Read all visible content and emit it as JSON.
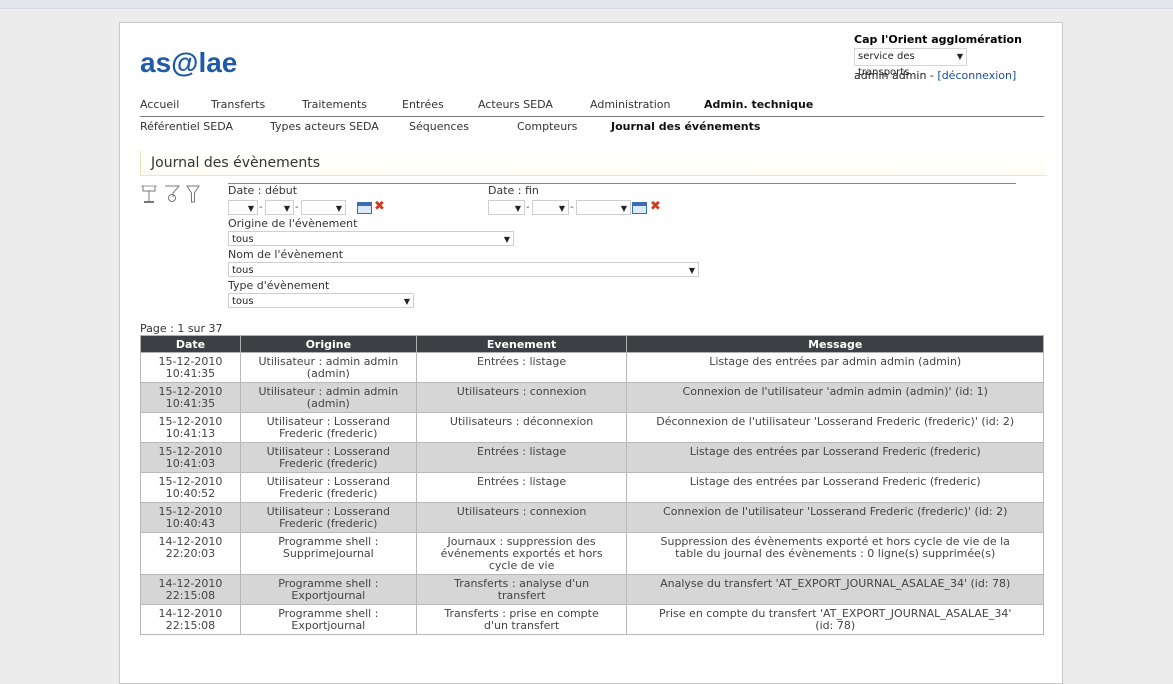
{
  "header": {
    "logo_text": "as@lae",
    "org_name": "Cap l'Orient agglomération",
    "service_value": "service des transports",
    "user_text": "admin admin - ",
    "logout_label": "[déconnexion]"
  },
  "menu_main": [
    {
      "label": "Accueil",
      "active": false
    },
    {
      "label": "Transferts",
      "active": false
    },
    {
      "label": "Traitements",
      "active": false
    },
    {
      "label": "Entrées",
      "active": false
    },
    {
      "label": "Acteurs SEDA",
      "active": false
    },
    {
      "label": "Administration",
      "active": false
    },
    {
      "label": "Admin. technique",
      "active": true
    }
  ],
  "menu_sub": [
    {
      "label": "Référentiel SEDA",
      "active": false
    },
    {
      "label": "Types acteurs SEDA",
      "active": false
    },
    {
      "label": "Séquences",
      "active": false
    },
    {
      "label": "Compteurs",
      "active": false
    },
    {
      "label": "Journal des événements",
      "active": true
    }
  ],
  "section_title": "Journal des évènements",
  "filters": {
    "date_start_label": "Date : début",
    "date_end_label": "Date : fin",
    "origin_label": "Origine de l'évènement",
    "origin_value": "tous",
    "name_label": "Nom de l'évènement",
    "name_value": "tous",
    "type_label": "Type d'évènement",
    "type_value": "tous"
  },
  "pagination": "Page : 1 sur 37",
  "table": {
    "columns": [
      "Date",
      "Origine",
      "Evenement",
      "Message"
    ],
    "rows": [
      {
        "date": "15-12-2010",
        "time": "10:41:35",
        "origin": [
          "Utilisateur : admin admin",
          "(admin)"
        ],
        "event": [
          "Entrées : listage"
        ],
        "message": [
          "Listage des entrées par admin admin (admin)"
        ]
      },
      {
        "date": "15-12-2010",
        "time": "10:41:35",
        "origin": [
          "Utilisateur : admin admin",
          "(admin)"
        ],
        "event": [
          "Utilisateurs : connexion"
        ],
        "message": [
          "Connexion de l'utilisateur 'admin admin (admin)' (id: 1)"
        ]
      },
      {
        "date": "15-12-2010",
        "time": "10:41:13",
        "origin": [
          "Utilisateur : Losserand",
          "Frederic (frederic)"
        ],
        "event": [
          "Utilisateurs : déconnexion"
        ],
        "message": [
          "Déconnexion de l'utilisateur 'Losserand Frederic (frederic)' (id: 2)"
        ]
      },
      {
        "date": "15-12-2010",
        "time": "10:41:03",
        "origin": [
          "Utilisateur : Losserand",
          "Frederic (frederic)"
        ],
        "event": [
          "Entrées : listage"
        ],
        "message": [
          "Listage des entrées par Losserand Frederic (frederic)"
        ]
      },
      {
        "date": "15-12-2010",
        "time": "10:40:52",
        "origin": [
          "Utilisateur : Losserand",
          "Frederic (frederic)"
        ],
        "event": [
          "Entrées : listage"
        ],
        "message": [
          "Listage des entrées par Losserand Frederic (frederic)"
        ]
      },
      {
        "date": "15-12-2010",
        "time": "10:40:43",
        "origin": [
          "Utilisateur : Losserand",
          "Frederic (frederic)"
        ],
        "event": [
          "Utilisateurs : connexion"
        ],
        "message": [
          "Connexion de l'utilisateur 'Losserand Frederic (frederic)' (id: 2)"
        ]
      },
      {
        "date": "14-12-2010",
        "time": "22:20:03",
        "origin": [
          "Programme shell :",
          "Supprimejournal"
        ],
        "event": [
          "Journaux : suppression des",
          "événements exportés et hors",
          "cycle de vie"
        ],
        "message": [
          "Suppression des évènements exporté et hors cycle de vie de la",
          "table du journal des évènements : 0 ligne(s) supprimée(s)"
        ]
      },
      {
        "date": "14-12-2010",
        "time": "22:15:08",
        "origin": [
          "Programme shell :",
          "Exportjournal"
        ],
        "event": [
          "Transferts : analyse d'un",
          "transfert"
        ],
        "message": [
          "Analyse du transfert 'AT_EXPORT_JOURNAL_ASALAE_34' (id: 78)"
        ]
      },
      {
        "date": "14-12-2010",
        "time": "22:15:08",
        "origin": [
          "Programme shell :",
          "Exportjournal"
        ],
        "event": [
          "Transferts : prise en compte",
          "d'un transfert"
        ],
        "message": [
          "Prise en compte du transfert 'AT_EXPORT_JOURNAL_ASALAE_34'",
          "(id: 78)"
        ]
      }
    ]
  },
  "colors": {
    "logo_blue": "#1e5aa8",
    "header_row": "#3c3f44",
    "alt_row": "#d6d6d6",
    "clear_red": "#d23a1e"
  }
}
